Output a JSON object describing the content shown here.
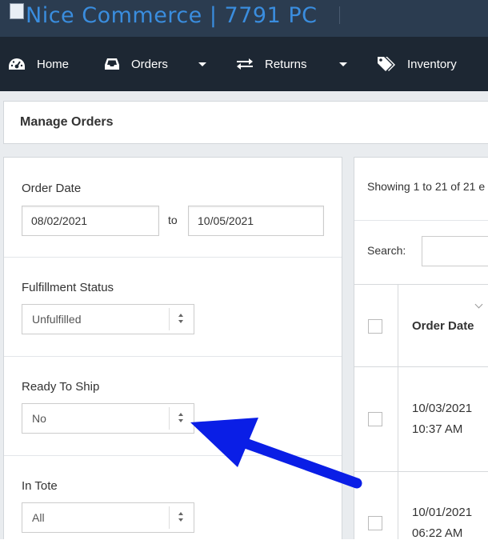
{
  "header": {
    "brand": "Nice Commerce | 7791 PC"
  },
  "nav": {
    "home": "Home",
    "orders": "Orders",
    "returns": "Returns",
    "inventory": "Inventory"
  },
  "page": {
    "title": "Manage Orders"
  },
  "filters": {
    "order_date": {
      "label": "Order Date",
      "from": "08/02/2021",
      "to_word": "to",
      "to": "10/05/2021"
    },
    "fulfillment_status": {
      "label": "Fulfillment Status",
      "value": "Unfulfilled"
    },
    "ready_to_ship": {
      "label": "Ready To Ship",
      "value": "No"
    },
    "in_tote": {
      "label": "In Tote",
      "value": "All"
    }
  },
  "orders": {
    "showing": "Showing 1 to 21 of 21 e",
    "search_label": "Search:",
    "columns": [
      "Order Date"
    ],
    "rows": [
      {
        "date": "10/03/2021",
        "time": "10:37 AM"
      },
      {
        "date": "10/01/2021",
        "time": "06:22 AM"
      }
    ]
  },
  "colors": {
    "topbar": "#2b3c50",
    "navbar": "#1d2733",
    "brand_text": "#3a8dde",
    "annotation_arrow": "#0a1ee6"
  },
  "icons": [
    "dashboard-icon",
    "inbox-tray-icon",
    "exchange-arrows-icon",
    "tags-icon",
    "caret-down-icon",
    "arrow-annotation"
  ]
}
